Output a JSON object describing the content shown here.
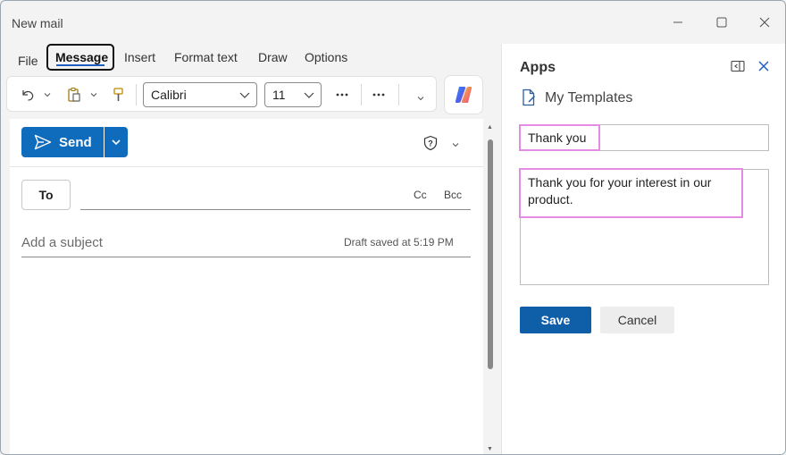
{
  "window": {
    "title": "New mail"
  },
  "menu": {
    "tabs": [
      {
        "label": "File"
      },
      {
        "label": "Message"
      },
      {
        "label": "Insert"
      },
      {
        "label": "Format text"
      },
      {
        "label": "Draw"
      },
      {
        "label": "Options"
      }
    ],
    "active_tab": "Message"
  },
  "ribbon": {
    "font_name": "Calibri",
    "font_size": "11",
    "icons": [
      "undo-icon",
      "paste-icon",
      "format-painter-icon",
      "more-icon",
      "copilot-icon"
    ]
  },
  "compose": {
    "send_label": "Send",
    "to_label": "To",
    "cc_label": "Cc",
    "bcc_label": "Bcc",
    "subject_placeholder": "Add a subject",
    "draft_status": "Draft saved at 5:19 PM"
  },
  "apps_pane": {
    "title": "Apps",
    "addin_name": "My Templates",
    "template_name": "Thank you",
    "template_body": "Thank you for your interest in our product.",
    "save_label": "Save",
    "cancel_label": "Cancel"
  },
  "colors": {
    "accent": "#0f6cbd",
    "highlight_border": "#e48ce4",
    "save_button": "#0f5ea8"
  }
}
